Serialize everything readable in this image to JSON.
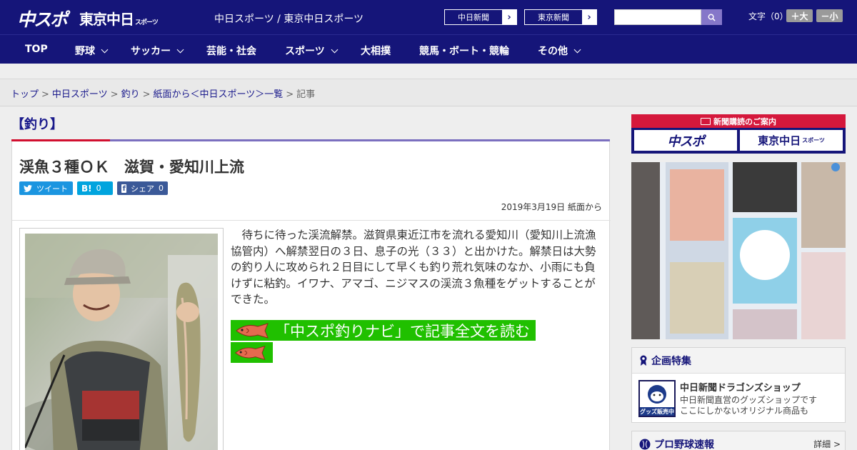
{
  "header": {
    "logo_main": "中スポ",
    "logo_tokyo": "東京中日",
    "logo_tokyo_sub": "スポーツ",
    "site_title": "中日スポーツ / 東京中日スポーツ",
    "paper_links": [
      "中日新聞",
      "東京新聞"
    ],
    "search": {
      "placeholder": "",
      "button_icon": "search-icon"
    },
    "font_size_label": "文字（0）",
    "font_larger": "＋大",
    "font_smaller": "－小"
  },
  "nav": {
    "items": [
      {
        "label": "TOP",
        "dropdown": false
      },
      {
        "label": "野球",
        "dropdown": true
      },
      {
        "label": "サッカー",
        "dropdown": true
      },
      {
        "label": "芸能・社会",
        "dropdown": false
      },
      {
        "label": "スポーツ",
        "dropdown": true
      },
      {
        "label": "大相撲",
        "dropdown": false
      },
      {
        "label": "競馬・ボート・競輪",
        "dropdown": false
      },
      {
        "label": "その他",
        "dropdown": true
      }
    ]
  },
  "breadcrumb": {
    "items": [
      "トップ",
      "中日スポーツ",
      "釣り",
      "紙面から＜中日スポーツ＞一覧"
    ],
    "current": "記事",
    "separator": ">"
  },
  "article": {
    "section": "【釣り】",
    "title": "渓魚３種ＯＫ　滋賀・愛知川上流",
    "share": {
      "tweet": "ツイート",
      "hatena_icon": "B!",
      "hatena_count": "0",
      "facebook": "シェア",
      "facebook_count": "0"
    },
    "date": "2019年3月19日 紙面から",
    "lead": "待ちに待った渓流解禁。滋賀県東近江市を流れる愛知川（愛知川上流漁協管内）へ解禁翌日の３日、息子の光（３３）と出かけた。解禁日は大勢の釣り人に攻められ２日目にして早くも釣り荒れ気味のなか、小雨にも負けずに粘釣。イワナ、アマゴ、ニジマスの渓流３魚種をゲットすることができた。",
    "navi_link": "「中スポ釣りナビ」で記事全文を読む"
  },
  "sidebar": {
    "subscription_header": "新聞購読のご案内",
    "subscription_logos": [
      "中スポ",
      "東京中日"
    ],
    "subscription_logo_sub": "スポーツ",
    "feature": {
      "header": "企画特集",
      "title": "中日新聞ドラゴンズショップ",
      "description_lines": [
        "中日新聞直営のグッズショップです",
        "ここにしかないオリジナル商品も"
      ],
      "image_caption": "グッズ販売中"
    },
    "baseball": {
      "header": "プロ野球速報",
      "more": "詳細 >"
    }
  },
  "colors": {
    "brand_navy": "#151579",
    "accent_red": "#d10f2f",
    "navi_green": "#20c000",
    "twitter_blue": "#1b95e0",
    "hatena_blue": "#00a4de",
    "facebook_blue": "#3b5998"
  }
}
